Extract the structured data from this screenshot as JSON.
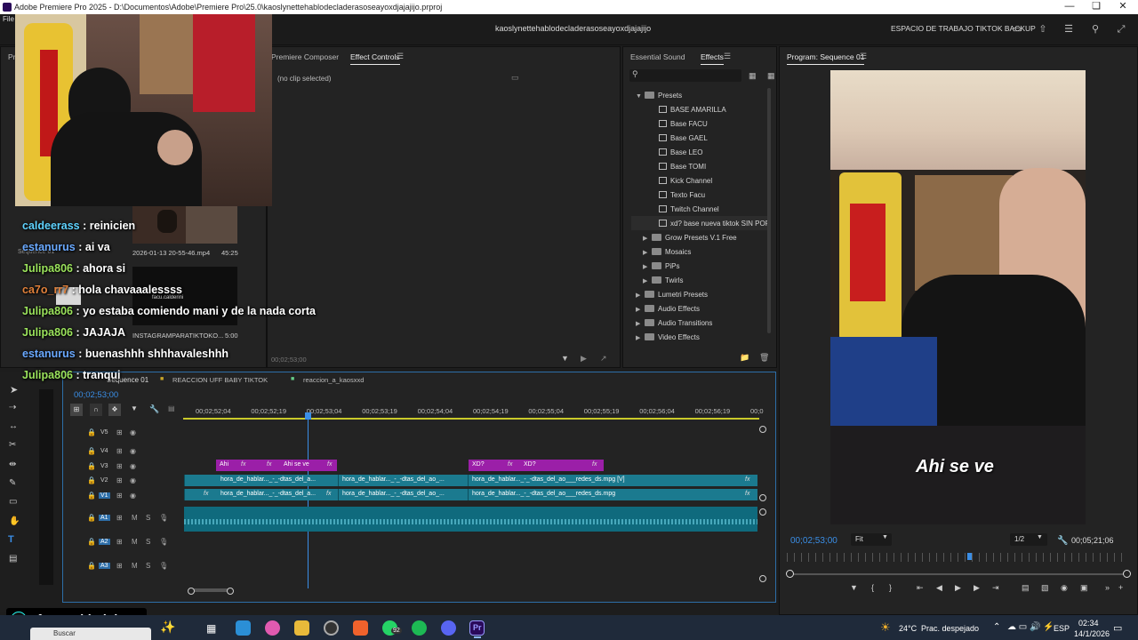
{
  "window": {
    "title": "Adobe Premiere Pro 2025 - D:\\Documentos\\Adobe\\Premiere Pro\\25.0\\kaoslynettehablodecladerasoseayoxdjajajijo.prproj"
  },
  "header": {
    "menu_file": "File",
    "project_name": "kaoslynettehablodecladerasoseayoxdjajajijo",
    "workspace": "ESPACIO DE TRABAJO TIKTOK BACKUP"
  },
  "top_left_panel": {
    "tab_partial": "Pr",
    "tab_composer": "Premiere Composer",
    "tab_effect_controls": "Effect Controls",
    "no_clip": "(no clip selected)",
    "timecode": "00;02;53;00"
  },
  "project_panel": {
    "items": [
      {
        "name": "2026-01-13 20-55-46.mp4",
        "duration": "45:25"
      },
      {
        "name": "INSTAGRAMPARATIKTOKO...",
        "duration": "5:00"
      }
    ],
    "seq_label": "Sequence 01",
    "thumb_caption": "facu.calderini"
  },
  "chat": [
    {
      "user": "caldeerass",
      "msg": ": reinicien",
      "color": "#5fd3ff"
    },
    {
      "user": "estanurus",
      "msg": ": ai va",
      "color": "#6aa9ff"
    },
    {
      "user": "Julipa806",
      "msg": ": ahora si",
      "color": "#9be35c"
    },
    {
      "user": "ca7o_rr7",
      "msg": ": hola chavaaalessss",
      "color": "#e0803a"
    },
    {
      "user": "Julipa806",
      "msg": ": yo estaba comiendo mani y de la nada corta",
      "color": "#9be35c"
    },
    {
      "user": "Julipa806",
      "msg": ": JAJAJA",
      "color": "#9be35c"
    },
    {
      "user": "estanurus",
      "msg": ": buenashhh shhhavaleshhh",
      "color": "#6aa9ff"
    },
    {
      "user": "Julipa806",
      "msg": ": tranqui",
      "color": "#9be35c"
    }
  ],
  "effects_panel": {
    "tab_essential": "Essential Sound",
    "tab_effects": "Effects",
    "search_placeholder": "",
    "tree": [
      {
        "label": "Presets",
        "type": "folder-open",
        "indent": 0
      },
      {
        "label": "BASE AMARILLA",
        "type": "preset",
        "indent": 2
      },
      {
        "label": "Base FACU",
        "type": "preset",
        "indent": 2
      },
      {
        "label": "Base GAEL",
        "type": "preset",
        "indent": 2
      },
      {
        "label": "Base LEO",
        "type": "preset",
        "indent": 2
      },
      {
        "label": "Base TOMI",
        "type": "preset",
        "indent": 2
      },
      {
        "label": "Kick Channel",
        "type": "preset",
        "indent": 2
      },
      {
        "label": "Texto Facu",
        "type": "preset",
        "indent": 2
      },
      {
        "label": "Twitch Channel",
        "type": "preset",
        "indent": 2
      },
      {
        "label": "xd? base nueva tiktok SIN POP",
        "type": "preset",
        "indent": 2
      },
      {
        "label": "Grow Presets V.1 Free",
        "type": "folder",
        "indent": 1
      },
      {
        "label": "Mosaics",
        "type": "folder",
        "indent": 1
      },
      {
        "label": "PiPs",
        "type": "folder",
        "indent": 1
      },
      {
        "label": "Twirls",
        "type": "folder",
        "indent": 1
      },
      {
        "label": "Lumetri Presets",
        "type": "folder",
        "indent": 0
      },
      {
        "label": "Audio Effects",
        "type": "folder",
        "indent": 0
      },
      {
        "label": "Audio Transitions",
        "type": "folder",
        "indent": 0
      },
      {
        "label": "Video Effects",
        "type": "folder",
        "indent": 0
      }
    ]
  },
  "timeline": {
    "tabs": [
      "Sequence 01",
      "REACCION UFF BABY TIKTOK",
      "reaccion_a_kaosxxd"
    ],
    "current_time": "00;02;53;00",
    "ruler": [
      "00;02;52;04",
      "00;02;52;19",
      "00;02;53;04",
      "00;02;53;19",
      "00;02;54;04",
      "00;02;54;19",
      "00;02;55;04",
      "00;02;55;19",
      "00;02;56;04",
      "00;02;56;19",
      "00;0"
    ],
    "tracks": [
      "V5",
      "V4",
      "V3",
      "V2",
      "V1",
      "A1",
      "A2",
      "A3"
    ],
    "track_m": "M",
    "track_s": "S",
    "clips_v3": [
      {
        "label": "Ahi"
      },
      {
        "label": "Ahi se ve"
      },
      {
        "label": "XD?"
      },
      {
        "label": "XD?"
      }
    ],
    "clip_hora": "hora_de_hablar..._-_-dtas_del_a...",
    "clip_hora2": "hora_de_hablar..._-_-dtas_del_ao_...",
    "clip_redes_v2": "hora_de_hablar..._-_-dtas_del_ao___redes_ds.mpg [V]",
    "clip_redes_v1": "hora_de_hablar..._-_-dtas_del_ao___redes_ds.mpg",
    "fx": "fx"
  },
  "program": {
    "title": "Program: Sequence 01",
    "caption": "Ahi se ve",
    "timecode": "00;02;53;00",
    "fit": "Fit",
    "resolution": "1/2",
    "duration": "00;05;21;06"
  },
  "stream_overlay": {
    "handle": "facu.calderini"
  },
  "taskbar": {
    "search": "Buscar",
    "weather": "24°C",
    "weather_desc": "Prac. despejado",
    "lang": "ESP",
    "time": "02:34",
    "date": "14/1/2026",
    "whatsapp_badge": "92"
  },
  "colors": {
    "accent_blue": "#2d8ceb",
    "clip_teal": "#1b7a8f",
    "clip_purple": "#9b1fa8",
    "playhead": "#3a8ee6"
  }
}
